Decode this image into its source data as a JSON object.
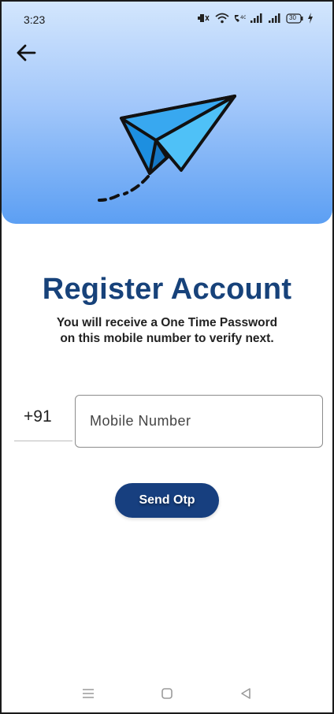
{
  "status_bar": {
    "time": "3:23",
    "battery": "30",
    "icons": [
      "mute-icon",
      "wifi-icon",
      "volte-icon",
      "signal-icon",
      "signal-icon",
      "battery-icon",
      "charging-icon"
    ]
  },
  "header": {
    "back_icon": "arrow-left-icon",
    "illustration": "paper-plane-icon",
    "gradient_colors": [
      "#d3e6fd",
      "#5c9ff3"
    ]
  },
  "main": {
    "title": "Register Account",
    "subtitle_line1": "You will receive a One Time Password",
    "subtitle_line2": "on this mobile number to verify next.",
    "country_code": "+91",
    "mobile_placeholder": "Mobile Number",
    "mobile_value": "",
    "send_button_label": "Send Otp"
  },
  "theme": {
    "title_color": "#17427a",
    "button_color": "#173f7f"
  },
  "nav_bar": {
    "icons": [
      "menu-icon",
      "home-icon",
      "back-triangle-icon"
    ]
  }
}
